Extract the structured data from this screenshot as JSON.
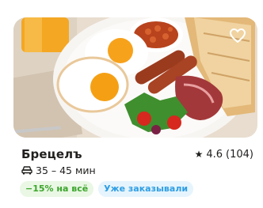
{
  "restaurant": {
    "name": "Брецелъ",
    "rating": "4.6",
    "reviews": "(104)",
    "delivery_time": "35 – 45 мин"
  },
  "icons": {
    "favorite": "heart-icon",
    "rating": "star-icon",
    "delivery": "car-icon"
  },
  "badges": [
    {
      "label": "−15% на всё",
      "color": "#3ba52b"
    },
    {
      "label": "Уже заказывали",
      "color": "#2f9ee4"
    }
  ]
}
